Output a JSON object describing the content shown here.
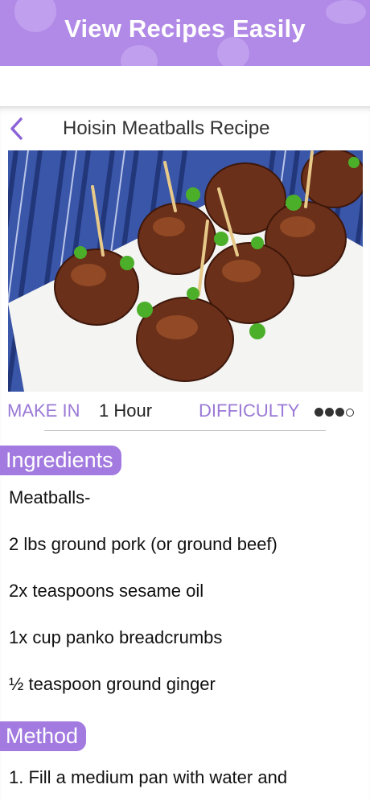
{
  "banner": {
    "title": "View Recipes Easily"
  },
  "nav": {
    "back_icon": "chevron-left-icon",
    "title": "Hoisin Meatballs Recipe"
  },
  "meta": {
    "make_in_label": "MAKE IN",
    "make_in_value": "1 Hour",
    "difficulty_label": "DIFFICULTY",
    "difficulty_level": 3,
    "difficulty_max": 4
  },
  "ingredients": {
    "heading": "Ingredients",
    "items": [
      "Meatballs-",
      "2 lbs ground pork (or ground beef)",
      "2x teaspoons sesame oil",
      "1x cup panko breadcrumbs",
      "½ teaspoon ground ginger"
    ]
  },
  "method": {
    "heading": "Method",
    "steps": [
      "1. Fill a medium pan with water and"
    ]
  },
  "colors": {
    "accent": "#a27ae0",
    "banner": "#b189e6",
    "label": "#9a79d6"
  }
}
